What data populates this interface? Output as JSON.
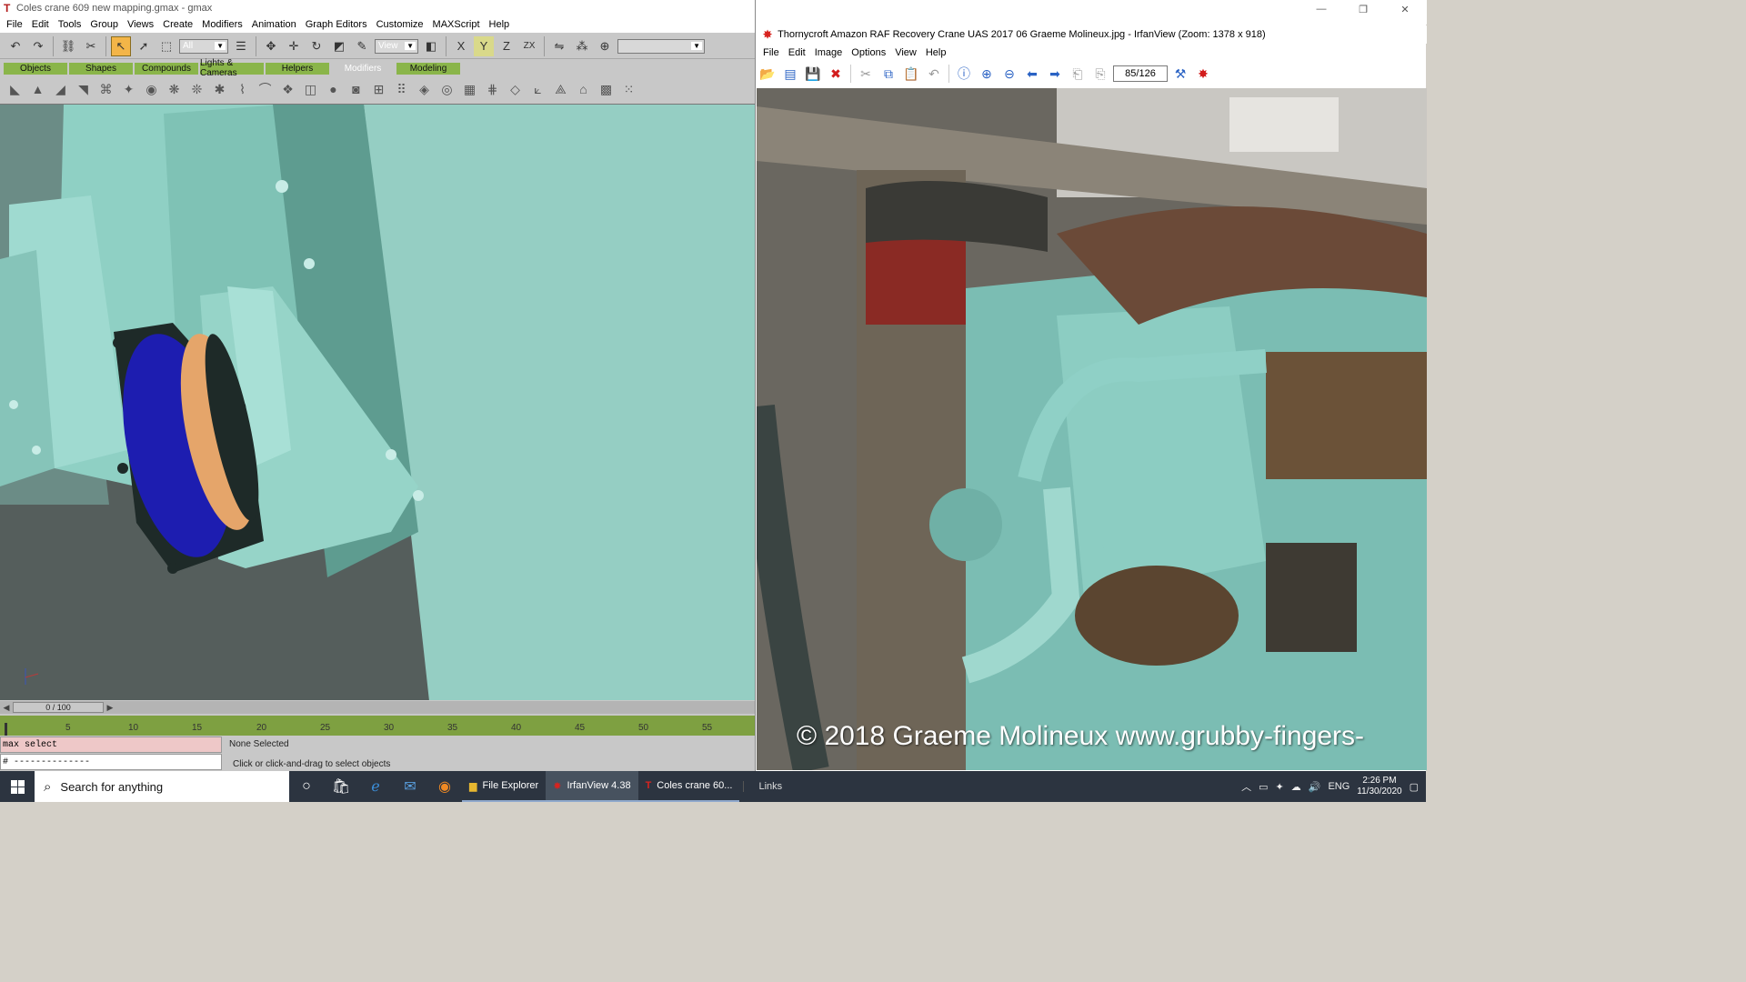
{
  "gmax": {
    "title": "Coles crane 609 new mapping.gmax - gmax",
    "menu": [
      "File",
      "Edit",
      "Tools",
      "Group",
      "Views",
      "Create",
      "Modifiers",
      "Animation",
      "Graph Editors",
      "Customize",
      "MAXScript",
      "Help"
    ],
    "selection_filter": "All",
    "ref_coord": "View",
    "tabs": [
      "Objects",
      "Shapes",
      "Compounds",
      "Lights & Cameras",
      "Helpers",
      "Modifiers",
      "Modeling"
    ],
    "active_tab": "Modifiers",
    "time_slider": "0 / 100",
    "trackbar_labels": [
      "5",
      "10",
      "15",
      "20",
      "25",
      "30",
      "35",
      "40",
      "45",
      "50",
      "55"
    ],
    "maxscript_listener": "max select",
    "maxscript_output": "# --------------",
    "selection_status": "None Selected",
    "prompt": "Click or click-and-drag to select objects",
    "colors": {
      "viewport_bg": "#95cec3",
      "model": "#8fd0c4",
      "active_tool": "#f3b548",
      "tab": "#8ab54a"
    }
  },
  "irfan": {
    "title": "Thornycroft Amazon RAF Recovery Crane UAS 2017 06 Graeme Molineux.jpg - IrfanView (Zoom: 1378 x 918)",
    "menu": [
      "File",
      "Edit",
      "Image",
      "Options",
      "View",
      "Help"
    ],
    "page_counter": "85/126",
    "watermark": "© 2018 Graeme Molineux www.grubby-fingers-"
  },
  "taskbar": {
    "search_placeholder": "Search for anything",
    "apps": [
      "File Explorer",
      "IrfanView 4.38",
      "Coles crane 60..."
    ],
    "links": "Links",
    "language": "ENG",
    "time": "2:26 PM",
    "date": "11/30/2020"
  }
}
